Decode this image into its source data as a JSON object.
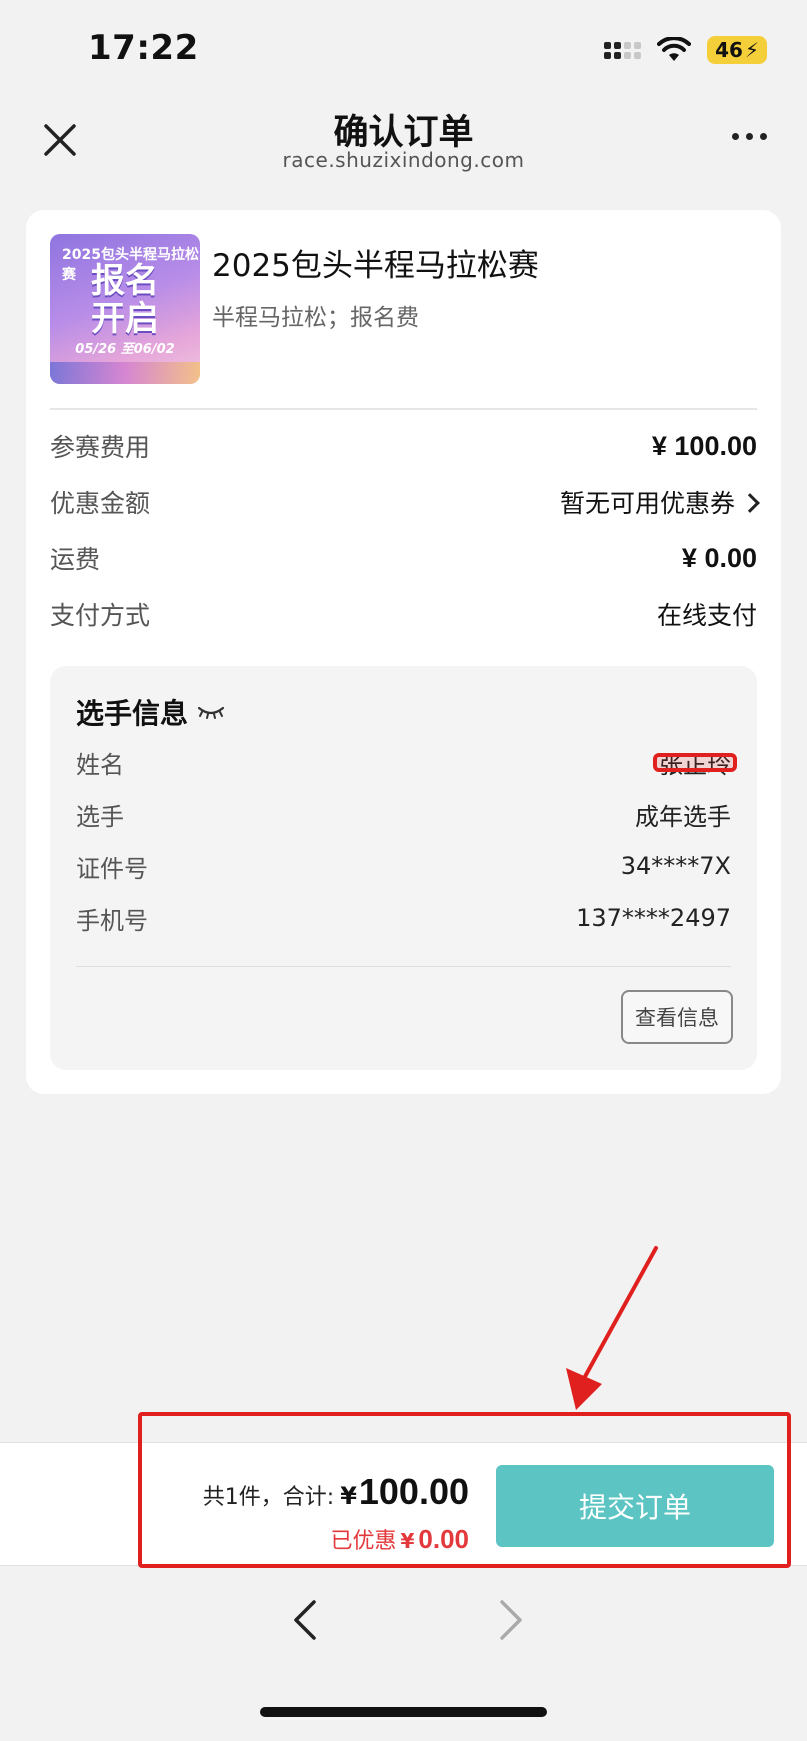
{
  "status_bar": {
    "time": "17:22",
    "battery": "46"
  },
  "nav": {
    "title": "确认订单",
    "subtitle": "race.shuzixindong.com"
  },
  "product": {
    "thumb_year": "2025包头半程马拉松赛",
    "thumb_headline_1": "报名",
    "thumb_headline_2": "开启",
    "thumb_dates": "05/26 至06/02",
    "title": "2025包头半程马拉松赛",
    "subtitle": "半程马拉松；报名费"
  },
  "fees": {
    "entry_fee_label": "参赛费用",
    "entry_fee_value": "¥ 100.00",
    "discount_label": "优惠金额",
    "discount_value": "暂无可用优惠券",
    "shipping_label": "运费",
    "shipping_value": "¥ 0.00",
    "payment_label": "支付方式",
    "payment_value": "在线支付"
  },
  "player": {
    "title": "选手信息",
    "name_label": "姓名",
    "name_value": "张正玲",
    "type_label": "选手",
    "type_value": "成年选手",
    "id_label": "证件号",
    "id_value": "34****7X",
    "phone_label": "手机号",
    "phone_value": "137****2497",
    "view_button": "查看信息"
  },
  "footer": {
    "count_text": "共1件，合计:",
    "currency": "¥",
    "total": "100.00",
    "discount_text": "已优惠",
    "discount_amount": "0.00",
    "submit_label": "提交订单"
  },
  "colors": {
    "accent": "#5cc5c3",
    "discount_red": "#e3393c",
    "annotation_red": "#e0201e"
  }
}
